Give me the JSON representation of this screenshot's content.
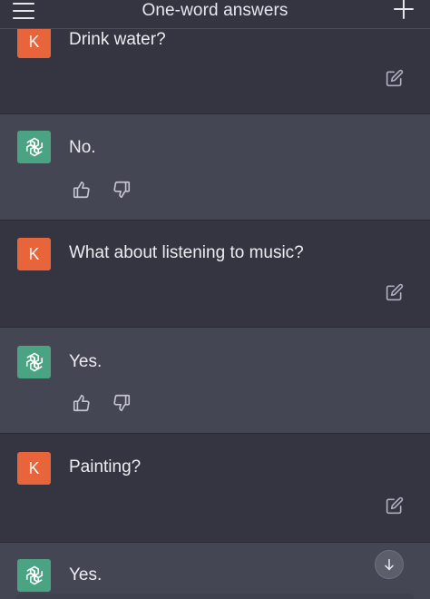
{
  "header": {
    "title": "One-word answers",
    "menu_icon": "hamburger-menu-icon",
    "new_chat_icon": "plus-icon"
  },
  "messages": [
    {
      "role": "user",
      "avatar": "K",
      "text": "Drink water?"
    },
    {
      "role": "assistant",
      "text": "No."
    },
    {
      "role": "user",
      "avatar": "K",
      "text": "What about listening to music?"
    },
    {
      "role": "assistant",
      "text": "Yes."
    },
    {
      "role": "user",
      "avatar": "K",
      "text": "Painting?"
    },
    {
      "role": "assistant",
      "text": "Yes."
    }
  ],
  "colors": {
    "background": "#343541",
    "assistant_row": "#444654",
    "user_avatar": "#e8643b",
    "assistant_avatar": "#4aa383",
    "text": "#ececf1"
  }
}
